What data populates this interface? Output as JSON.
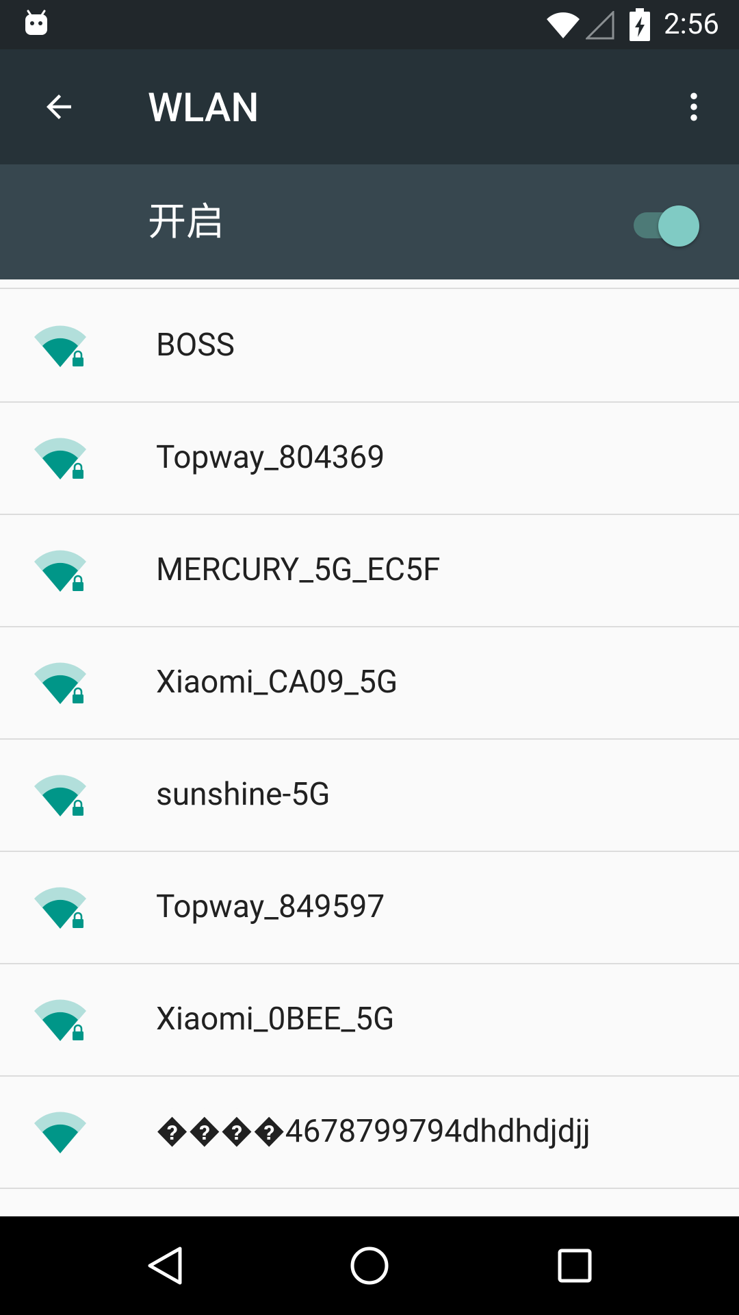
{
  "status_bar": {
    "time": "2:56"
  },
  "toolbar": {
    "title": "WLAN"
  },
  "wifi_switch": {
    "label": "开启",
    "checked": true
  },
  "colors": {
    "status_bar": "#21272b",
    "toolbar": "#263238",
    "switch_bar": "#37474f",
    "accent": "#009688",
    "accent_light": "#b2dfdb",
    "toggle_thumb": "#80cbc4",
    "list_background": "#fafafa",
    "nav_bar": "#000000"
  },
  "networks": [
    {
      "ssid": "BOSS",
      "secured": true,
      "icon": "wifi-signal-locked-icon"
    },
    {
      "ssid": "Topway_804369",
      "secured": true,
      "icon": "wifi-signal-locked-icon"
    },
    {
      "ssid": "MERCURY_5G_EC5F",
      "secured": true,
      "icon": "wifi-signal-locked-icon"
    },
    {
      "ssid": "Xiaomi_CA09_5G",
      "secured": true,
      "icon": "wifi-signal-locked-icon"
    },
    {
      "ssid": "sunshine-5G",
      "secured": true,
      "icon": "wifi-signal-locked-icon"
    },
    {
      "ssid": "Topway_849597",
      "secured": true,
      "icon": "wifi-signal-locked-icon"
    },
    {
      "ssid": "Xiaomi_0BEE_5G",
      "secured": true,
      "icon": "wifi-signal-locked-icon"
    },
    {
      "ssid": "����4678799794dhdhdjdjj",
      "secured": false,
      "icon": "wifi-signal-icon"
    }
  ],
  "navigation": {
    "icons": [
      "back-icon",
      "home-icon",
      "recents-icon"
    ]
  }
}
